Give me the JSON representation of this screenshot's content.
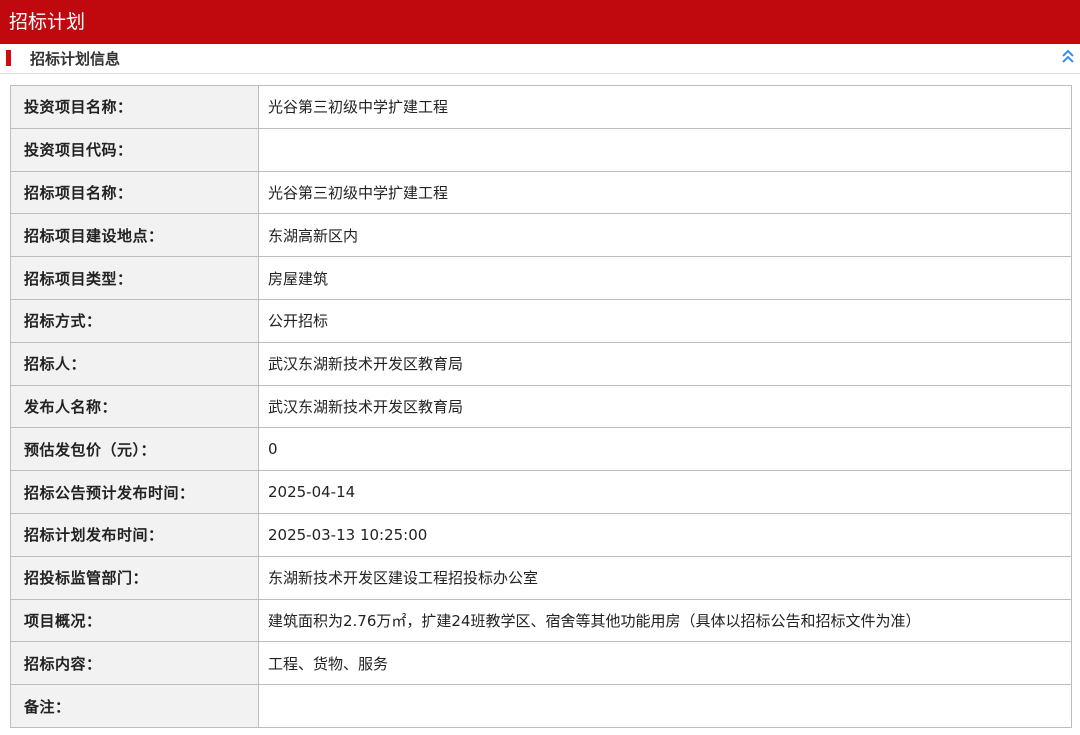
{
  "header": {
    "title": "招标计划"
  },
  "section": {
    "title": "招标计划信息",
    "collapse_icon": "double-chevron-up-icon"
  },
  "colors": {
    "header_bg": "#c0090f",
    "accent": "#d4090f",
    "label_bg": "#f2f2f2"
  },
  "rows": [
    {
      "label": "投资项目名称：",
      "value": "光谷第三初级中学扩建工程"
    },
    {
      "label": "投资项目代码：",
      "value": ""
    },
    {
      "label": "招标项目名称：",
      "value": "光谷第三初级中学扩建工程"
    },
    {
      "label": "招标项目建设地点：",
      "value": "东湖高新区内"
    },
    {
      "label": "招标项目类型：",
      "value": "房屋建筑"
    },
    {
      "label": "招标方式：",
      "value": "公开招标"
    },
    {
      "label": "招标人：",
      "value": "武汉东湖新技术开发区教育局"
    },
    {
      "label": "发布人名称：",
      "value": "武汉东湖新技术开发区教育局"
    },
    {
      "label": "预估发包价（元）：",
      "value": "0"
    },
    {
      "label": "招标公告预计发布时间：",
      "value": "2025-04-14"
    },
    {
      "label": "招标计划发布时间：",
      "value": "2025-03-13 10:25:00"
    },
    {
      "label": "招投标监管部门：",
      "value": "东湖新技术开发区建设工程招投标办公室"
    },
    {
      "label": "项目概况：",
      "value": "建筑面积为2.76万㎡，扩建24班教学区、宿舍等其他功能用房（具体以招标公告和招标文件为准）"
    },
    {
      "label": "招标内容：",
      "value": "工程、货物、服务"
    },
    {
      "label": "备注：",
      "value": ""
    }
  ]
}
